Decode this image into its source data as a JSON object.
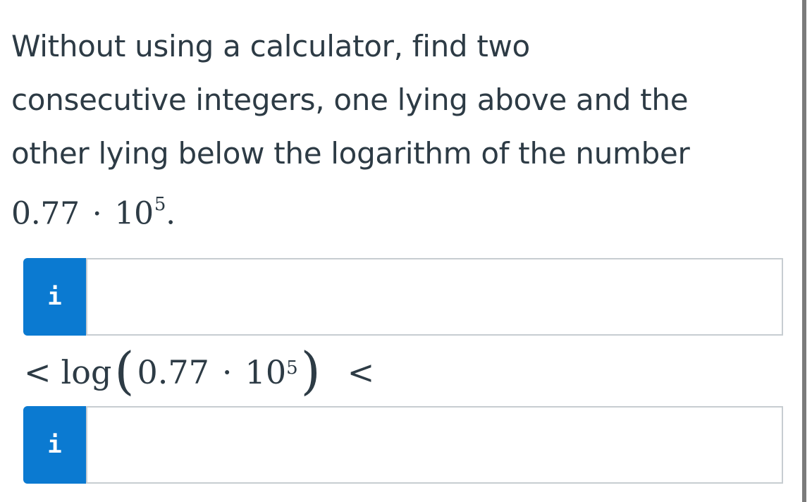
{
  "question": {
    "line1": "Without using a calculator, find two",
    "line2": "consecutive integers, one lying above and the",
    "line3": "other lying below the logarithm of the number",
    "number": {
      "mantissa": "0.77",
      "operator": "·",
      "base": "10",
      "exponent": "5",
      "end": "."
    }
  },
  "inputs": {
    "lower": {
      "button_label": "i",
      "value": ""
    },
    "upper": {
      "button_label": "i",
      "value": ""
    }
  },
  "inequality": {
    "lt_left": "<",
    "func": "log",
    "open": "(",
    "mantissa": "0.77",
    "operator": "·",
    "base": "10",
    "exponent": "5",
    "close": ")",
    "lt_right": "<"
  },
  "colors": {
    "accent": "#0b7ad1",
    "text": "#2d3b45",
    "input_border": "#c7cdd1"
  },
  "icons": {
    "info_button": "info-icon"
  }
}
